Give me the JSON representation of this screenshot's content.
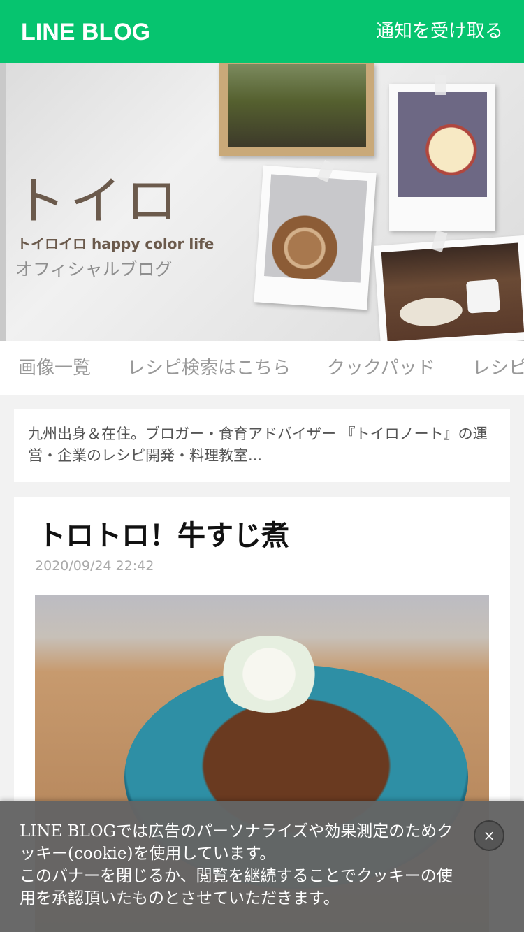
{
  "header": {
    "logo_text": "LINE BLOG",
    "notify_label": "通知を受け取る"
  },
  "hero": {
    "blog_name": "トイロ",
    "subtitle": "トイロイロ happy color life",
    "official_label": "オフィシャルブログ"
  },
  "nav": {
    "tabs": [
      {
        "label": "画像一覧"
      },
      {
        "label": "レシピ検索はこちら"
      },
      {
        "label": "クックパッド"
      },
      {
        "label": "レシピ"
      }
    ]
  },
  "profile": {
    "description": "九州出身＆在住。ブロガー・食育アドバイザー 『トイロノート』の運営・企業のレシピ開発・料理教室..."
  },
  "article": {
    "title": "トロトロ！牛すじ煮",
    "date": "2020/09/24 22:42"
  },
  "cookie_banner": {
    "text_line1": "LINE BLOGでは広告のパーソナライズや効果測定のためクッキー(cookie)を使用しています。",
    "text_line2": "このバナーを閉じるか、閲覧を継続することでクッキーの使用を承認頂いたものとさせていただきます。",
    "close_label": "×"
  },
  "colors": {
    "brand_green": "#06c46f",
    "banner_gray": "#646464"
  }
}
